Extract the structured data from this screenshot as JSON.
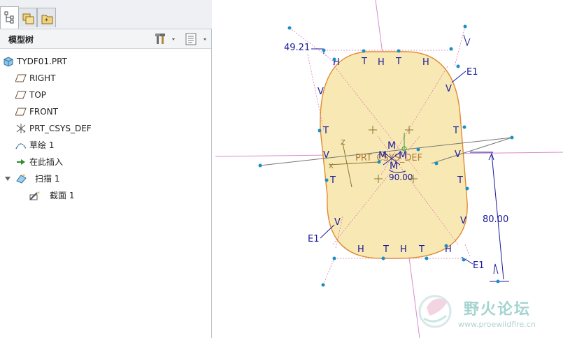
{
  "tabs": [
    {
      "name": "model-tree-tab",
      "icon": "model-tree-icon",
      "active": true
    },
    {
      "name": "folder-browser-tab",
      "icon": "folder-icon",
      "active": false
    },
    {
      "name": "favorites-tab",
      "icon": "favorites-icon",
      "active": false
    }
  ],
  "panel": {
    "title": "模型树",
    "settings_icon": "tools-icon",
    "show_icon": "list-icon"
  },
  "tree": {
    "root": "TYDF01.PRT",
    "items": [
      {
        "label": "RIGHT",
        "icon": "datum-plane-icon"
      },
      {
        "label": "TOP",
        "icon": "datum-plane-icon"
      },
      {
        "label": "FRONT",
        "icon": "datum-plane-icon"
      },
      {
        "label": "PRT_CSYS_DEF",
        "icon": "csys-icon"
      },
      {
        "label": "草绘 1",
        "icon": "sketch-icon"
      },
      {
        "label": "在此插入",
        "icon": "insert-here-icon"
      },
      {
        "label": "扫描 1",
        "icon": "sweep-icon"
      },
      {
        "label": "截面 1",
        "icon": "section-icon"
      }
    ]
  },
  "sketch": {
    "dim_top": "49.21",
    "dim_right": "80.00",
    "dim_angle": "90.00",
    "csys_label": "PRT_CSYS_DEF",
    "label_e1": "E1",
    "label_h": "H",
    "label_t": "T",
    "label_v": "V",
    "label_m": "M",
    "axis_z": "Z",
    "axis_x": "X",
    "fill_color": "#f8e9b4",
    "stroke_color": "#e08a2e",
    "dim_color": "#1a1a9c"
  },
  "watermark": {
    "text": "野火论坛",
    "url": "www.proewildfire.cn"
  }
}
